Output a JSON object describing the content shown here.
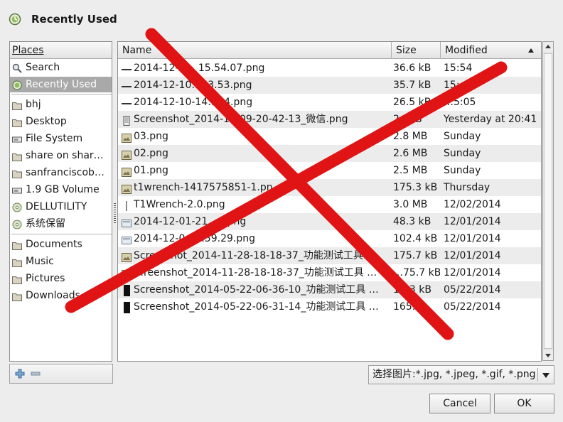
{
  "window": {
    "title": "Recently Used"
  },
  "places": {
    "header": "Places",
    "items": [
      {
        "label": "Search",
        "icon": "search-icon"
      },
      {
        "label": "Recently Used",
        "icon": "recent-icon",
        "selected": true
      },
      {
        "label": "bhj",
        "icon": "folder-icon"
      },
      {
        "label": "Desktop",
        "icon": "folder-icon"
      },
      {
        "label": "File System",
        "icon": "drive-icon"
      },
      {
        "label": "share on shar…",
        "icon": "folder-icon"
      },
      {
        "label": "sanfranciscob…",
        "icon": "folder-icon"
      },
      {
        "label": "1.9 GB Volume",
        "icon": "drive-icon"
      },
      {
        "label": "DELLUTILITY",
        "icon": "disc-icon"
      },
      {
        "label": "系统保留",
        "icon": "disc-icon"
      },
      {
        "label": "Documents",
        "icon": "folder-icon"
      },
      {
        "label": "Music",
        "icon": "folder-icon"
      },
      {
        "label": "Pictures",
        "icon": "folder-icon"
      },
      {
        "label": "Downloads",
        "icon": "folder-icon"
      }
    ]
  },
  "files": {
    "columns": {
      "name": "Name",
      "size": "Size",
      "modified": "Modified"
    },
    "sort": "modified-ascending",
    "rows": [
      {
        "name": "2014-12-1… 15.54.07.png",
        "size": "36.6 kB",
        "modified": "15:54",
        "icon": "line-image-icon"
      },
      {
        "name": "2014-12-10…53.53.png",
        "size": "35.7 kB",
        "modified": "15:…",
        "icon": "line-image-icon"
      },
      {
        "name": "2014-12-10-14…34.png",
        "size": "26.5 kB",
        "modified": "…5:05",
        "icon": "line-image-icon"
      },
      {
        "name": "Screenshot_2014-1…09-20-42-13_微信.png",
        "size": "2…kB",
        "modified": "Yesterday at 20:41",
        "icon": "phone-image-icon"
      },
      {
        "name": "03.png",
        "size": "2.8 MB",
        "modified": "Sunday",
        "icon": "photo-icon"
      },
      {
        "name": "02.png",
        "size": "2.6 MB",
        "modified": "Sunday",
        "icon": "photo-icon"
      },
      {
        "name": "01.png",
        "size": "2.5 MB",
        "modified": "Sunday",
        "icon": "photo-icon"
      },
      {
        "name": "t1wrench-1417575851-1.pn…",
        "size": "175.3 kB",
        "modified": "Thursday",
        "icon": "photo-icon"
      },
      {
        "name": "T1Wrench-2.0.png",
        "size": "3.0 MB",
        "modified": "12/02/2014",
        "icon": "thin-image-icon"
      },
      {
        "name": "2014-12-01-21…0.png",
        "size": "48.3 kB",
        "modified": "12/01/2014",
        "icon": "doc-image-icon"
      },
      {
        "name": "2014-12-0…1.59.29.png",
        "size": "102.4 kB",
        "modified": "12/01/2014",
        "icon": "doc-image-icon"
      },
      {
        "name": "Scre…shot_2014-11-28-18-18-37_功能测试工具…",
        "size": "175.7 kB",
        "modified": "12/01/2014",
        "icon": "photo-icon"
      },
      {
        "name": "…reenshot_2014-11-28-18-18-37_功能测试工具 …",
        "size": "…75.7 kB",
        "modified": "12/01/2014",
        "icon": "photo-icon"
      },
      {
        "name": "Screenshot_2014-05-22-06-36-10_功能测试工具 …",
        "size": "1…3 kB",
        "modified": "05/22/2014",
        "icon": "dark-phone-icon"
      },
      {
        "name": "Screenshot_2014-05-22-06-31-14_功能测试工具 …",
        "size": "165.…",
        "modified": "05/22/2014",
        "icon": "dark-phone-icon"
      }
    ]
  },
  "filter": {
    "value": "选择图片:*.jpg, *.jpeg, *.gif, *.png"
  },
  "buttons": {
    "cancel": "Cancel",
    "ok": "OK"
  },
  "overlay": {
    "type": "red-cross",
    "color": "#e01414"
  }
}
